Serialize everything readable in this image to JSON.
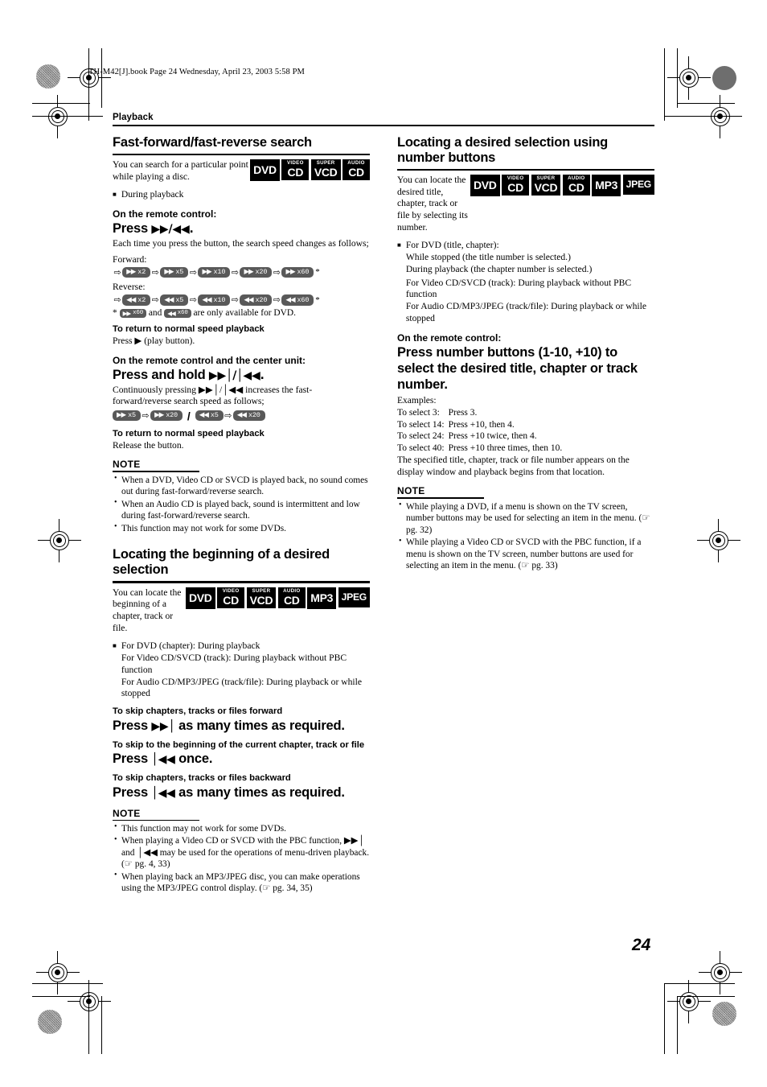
{
  "file_header": "TH-M42[J].book  Page 24  Wednesday, April 23, 2003  5:58 PM",
  "breadcrumb": "Playback",
  "page_number": "24",
  "colors": {
    "badge_bg": "#000000",
    "badge_fg": "#ffffff",
    "chip_bg": "#595959",
    "chip_fg": "#ffffff"
  },
  "left": {
    "section_title": "Fast-forward/fast-reverse search",
    "intro": "You can search for a particular point while playing a disc.",
    "badges": [
      {
        "top": "",
        "main": "DVD"
      },
      {
        "top": "VIDEO",
        "main": "CD"
      },
      {
        "top": "SUPER",
        "main": "VCD"
      },
      {
        "top": "AUDIO",
        "main": "CD"
      }
    ],
    "bullet1": "During playback",
    "lead1": "On the remote control:",
    "press1_prefix": "Press",
    "press1_glyph": "▶▶/◀◀.",
    "body1": "Each time you press the button, the search speed changes as follows;",
    "forward_label": "Forward:",
    "forward_chips": [
      {
        "dir": "ff",
        "speed": "x2"
      },
      {
        "dir": "ff",
        "speed": "x5"
      },
      {
        "dir": "ff",
        "speed": "x10"
      },
      {
        "dir": "ff",
        "speed": "x20"
      },
      {
        "dir": "ff",
        "speed": "x60"
      }
    ],
    "reverse_label": "Reverse:",
    "reverse_chips": [
      {
        "dir": "rw",
        "speed": "x2"
      },
      {
        "dir": "rw",
        "speed": "x5"
      },
      {
        "dir": "rw",
        "speed": "x10"
      },
      {
        "dir": "rw",
        "speed": "x20"
      },
      {
        "dir": "rw",
        "speed": "x60"
      }
    ],
    "footnote_star": "*",
    "footnote_mid": "and",
    "footnote_end": "are only available for DVD.",
    "footnote_chip1": "x60",
    "footnote_chip2": "x60",
    "subhead1": "To return to normal speed playback",
    "body2": "Press ▶ (play button).",
    "lead2": "On the remote control and the center unit:",
    "press2_prefix": "Press and hold",
    "press2_glyph": "▶▶│/│◀◀.",
    "body3": "Continuously pressing ▶▶│/│◀◀ increases the fast-forward/reverse search speed as follows;",
    "hold_chips_fwd": [
      {
        "dir": "ff",
        "speed": "x5"
      },
      {
        "dir": "ff",
        "speed": "x20"
      }
    ],
    "hold_chips_rev": [
      {
        "dir": "rw",
        "speed": "x5"
      },
      {
        "dir": "rw",
        "speed": "x20"
      }
    ],
    "subhead2": "To return to normal speed playback",
    "body4": "Release the button.",
    "note_title": "NOTE",
    "notes": [
      "When a DVD, Video CD or SVCD is played back, no sound comes out during fast-forward/reverse search.",
      "When an Audio CD is played back, sound is intermittent and low during fast-forward/reverse search.",
      "This function may not work for some DVDs."
    ]
  },
  "left2": {
    "section_title": "Locating the beginning of a desired selection",
    "intro": "You can locate the beginning of a chapter, track or file.",
    "badges": [
      {
        "top": "",
        "main": "DVD"
      },
      {
        "top": "VIDEO",
        "main": "CD"
      },
      {
        "top": "SUPER",
        "main": "VCD"
      },
      {
        "top": "AUDIO",
        "main": "CD"
      },
      {
        "top": "",
        "main": "MP3"
      },
      {
        "top": "",
        "main": "JPEG"
      }
    ],
    "bullet_lines": [
      "For DVD (chapter): During playback",
      "For Video CD/SVCD (track): During playback without PBC function",
      "For Audio CD/MP3/JPEG (track/file): During playback or while stopped"
    ],
    "subhead1": "To skip chapters, tracks or files forward",
    "press1_prefix": "Press",
    "press1_glyph": "▶▶│",
    "press1_suffix": "as many times as required.",
    "subhead2": "To skip to the beginning of the current chapter, track or file",
    "press2_prefix": "Press",
    "press2_glyph": "│◀◀",
    "press2_suffix": "once.",
    "subhead3": "To skip chapters, tracks or files backward",
    "press3_prefix": "Press",
    "press3_glyph": "│◀◀",
    "press3_suffix": "as many times as required.",
    "note_title": "NOTE",
    "notes": [
      "This function may not work for some DVDs.",
      "When playing a Video CD or SVCD with the PBC function, ▶▶│ and │◀◀ may be used for the operations of menu-driven playback. (☞ pg. 4, 33)",
      "When playing back an MP3/JPEG disc, you can make operations using the MP3/JPEG control display. (☞ pg. 34, 35)"
    ]
  },
  "right": {
    "section_title": "Locating a desired selection using number buttons",
    "intro": "You can locate the desired title, chapter, track or file by selecting its number.",
    "badges": [
      {
        "top": "",
        "main": "DVD"
      },
      {
        "top": "VIDEO",
        "main": "CD"
      },
      {
        "top": "SUPER",
        "main": "VCD"
      },
      {
        "top": "AUDIO",
        "main": "CD"
      },
      {
        "top": "",
        "main": "MP3"
      },
      {
        "top": "",
        "main": "JPEG"
      }
    ],
    "bullet_lines": [
      "For DVD (title, chapter):",
      "While stopped (the title number is selected.)",
      "During playback (the chapter number is selected.)",
      "For Video CD/SVCD (track): During playback without PBC function",
      "For Audio CD/MP3/JPEG (track/file): During playback or while stopped"
    ],
    "lead1": "On the remote control:",
    "press1": "Press number buttons (1-10, +10) to select the desired title, chapter or track number.",
    "examples_title": "Examples:",
    "examples": [
      {
        "label": "To select 3:",
        "action": "Press 3."
      },
      {
        "label": "To select 14:",
        "action": "Press +10, then 4."
      },
      {
        "label": "To select 24:",
        "action": "Press +10 twice, then 4."
      },
      {
        "label": "To select 40:",
        "action": "Press +10 three times, then 10."
      }
    ],
    "examples_footer": "The specified title, chapter, track or file number appears on the display window and playback begins from that location.",
    "note_title": "NOTE",
    "notes": [
      "While playing a DVD, if a menu is shown on the TV screen, number buttons may be used for selecting an item in the menu. (☞ pg. 32)",
      "While playing a Video CD or SVCD with the PBC function, if a menu is shown on the TV screen, number buttons are used for selecting an item in the menu. (☞ pg. 33)"
    ]
  }
}
